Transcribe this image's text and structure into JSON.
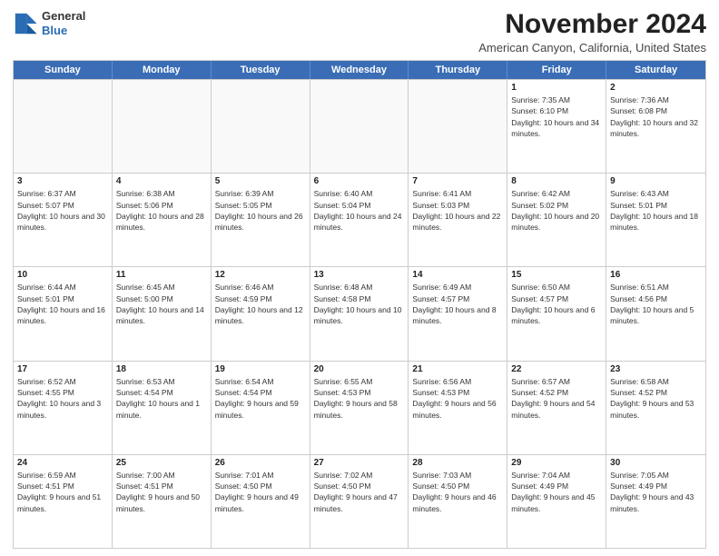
{
  "header": {
    "logo": {
      "line1": "General",
      "line2": "Blue"
    },
    "month": "November 2024",
    "location": "American Canyon, California, United States"
  },
  "days_of_week": [
    "Sunday",
    "Monday",
    "Tuesday",
    "Wednesday",
    "Thursday",
    "Friday",
    "Saturday"
  ],
  "weeks": [
    [
      {
        "day": "",
        "empty": true
      },
      {
        "day": "",
        "empty": true
      },
      {
        "day": "",
        "empty": true
      },
      {
        "day": "",
        "empty": true
      },
      {
        "day": "",
        "empty": true
      },
      {
        "day": "1",
        "info": "Sunrise: 7:35 AM\nSunset: 6:10 PM\nDaylight: 10 hours and 34 minutes."
      },
      {
        "day": "2",
        "info": "Sunrise: 7:36 AM\nSunset: 6:08 PM\nDaylight: 10 hours and 32 minutes."
      }
    ],
    [
      {
        "day": "3",
        "info": "Sunrise: 6:37 AM\nSunset: 5:07 PM\nDaylight: 10 hours and 30 minutes."
      },
      {
        "day": "4",
        "info": "Sunrise: 6:38 AM\nSunset: 5:06 PM\nDaylight: 10 hours and 28 minutes."
      },
      {
        "day": "5",
        "info": "Sunrise: 6:39 AM\nSunset: 5:05 PM\nDaylight: 10 hours and 26 minutes."
      },
      {
        "day": "6",
        "info": "Sunrise: 6:40 AM\nSunset: 5:04 PM\nDaylight: 10 hours and 24 minutes."
      },
      {
        "day": "7",
        "info": "Sunrise: 6:41 AM\nSunset: 5:03 PM\nDaylight: 10 hours and 22 minutes."
      },
      {
        "day": "8",
        "info": "Sunrise: 6:42 AM\nSunset: 5:02 PM\nDaylight: 10 hours and 20 minutes."
      },
      {
        "day": "9",
        "info": "Sunrise: 6:43 AM\nSunset: 5:01 PM\nDaylight: 10 hours and 18 minutes."
      }
    ],
    [
      {
        "day": "10",
        "info": "Sunrise: 6:44 AM\nSunset: 5:01 PM\nDaylight: 10 hours and 16 minutes."
      },
      {
        "day": "11",
        "info": "Sunrise: 6:45 AM\nSunset: 5:00 PM\nDaylight: 10 hours and 14 minutes."
      },
      {
        "day": "12",
        "info": "Sunrise: 6:46 AM\nSunset: 4:59 PM\nDaylight: 10 hours and 12 minutes."
      },
      {
        "day": "13",
        "info": "Sunrise: 6:48 AM\nSunset: 4:58 PM\nDaylight: 10 hours and 10 minutes."
      },
      {
        "day": "14",
        "info": "Sunrise: 6:49 AM\nSunset: 4:57 PM\nDaylight: 10 hours and 8 minutes."
      },
      {
        "day": "15",
        "info": "Sunrise: 6:50 AM\nSunset: 4:57 PM\nDaylight: 10 hours and 6 minutes."
      },
      {
        "day": "16",
        "info": "Sunrise: 6:51 AM\nSunset: 4:56 PM\nDaylight: 10 hours and 5 minutes."
      }
    ],
    [
      {
        "day": "17",
        "info": "Sunrise: 6:52 AM\nSunset: 4:55 PM\nDaylight: 10 hours and 3 minutes."
      },
      {
        "day": "18",
        "info": "Sunrise: 6:53 AM\nSunset: 4:54 PM\nDaylight: 10 hours and 1 minute."
      },
      {
        "day": "19",
        "info": "Sunrise: 6:54 AM\nSunset: 4:54 PM\nDaylight: 9 hours and 59 minutes."
      },
      {
        "day": "20",
        "info": "Sunrise: 6:55 AM\nSunset: 4:53 PM\nDaylight: 9 hours and 58 minutes."
      },
      {
        "day": "21",
        "info": "Sunrise: 6:56 AM\nSunset: 4:53 PM\nDaylight: 9 hours and 56 minutes."
      },
      {
        "day": "22",
        "info": "Sunrise: 6:57 AM\nSunset: 4:52 PM\nDaylight: 9 hours and 54 minutes."
      },
      {
        "day": "23",
        "info": "Sunrise: 6:58 AM\nSunset: 4:52 PM\nDaylight: 9 hours and 53 minutes."
      }
    ],
    [
      {
        "day": "24",
        "info": "Sunrise: 6:59 AM\nSunset: 4:51 PM\nDaylight: 9 hours and 51 minutes."
      },
      {
        "day": "25",
        "info": "Sunrise: 7:00 AM\nSunset: 4:51 PM\nDaylight: 9 hours and 50 minutes."
      },
      {
        "day": "26",
        "info": "Sunrise: 7:01 AM\nSunset: 4:50 PM\nDaylight: 9 hours and 49 minutes."
      },
      {
        "day": "27",
        "info": "Sunrise: 7:02 AM\nSunset: 4:50 PM\nDaylight: 9 hours and 47 minutes."
      },
      {
        "day": "28",
        "info": "Sunrise: 7:03 AM\nSunset: 4:50 PM\nDaylight: 9 hours and 46 minutes."
      },
      {
        "day": "29",
        "info": "Sunrise: 7:04 AM\nSunset: 4:49 PM\nDaylight: 9 hours and 45 minutes."
      },
      {
        "day": "30",
        "info": "Sunrise: 7:05 AM\nSunset: 4:49 PM\nDaylight: 9 hours and 43 minutes."
      }
    ]
  ]
}
